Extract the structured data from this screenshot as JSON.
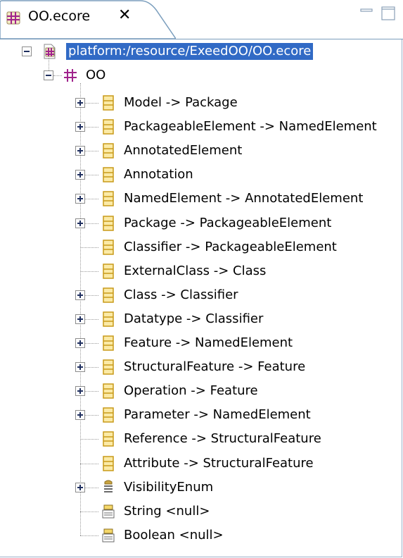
{
  "tab": {
    "title": "OO.ecore",
    "close_glyph": "✕",
    "icon": "ecore-package-icon"
  },
  "window_controls": [
    "minimize-icon",
    "maximize-icon"
  ],
  "tree": {
    "resource": {
      "label": "platform:/resource/ExeedOO/OO.ecore",
      "expanded": true,
      "selected": true
    },
    "package": {
      "label": "OO",
      "expanded": true
    },
    "items": [
      {
        "label": "Model -> Package",
        "kind": "class",
        "expandable": true
      },
      {
        "label": "PackageableElement -> NamedElement",
        "kind": "class",
        "expandable": true
      },
      {
        "label": "AnnotatedElement",
        "kind": "class",
        "expandable": true
      },
      {
        "label": "Annotation",
        "kind": "class",
        "expandable": true
      },
      {
        "label": "NamedElement -> AnnotatedElement",
        "kind": "class",
        "expandable": true
      },
      {
        "label": "Package -> PackageableElement",
        "kind": "class",
        "expandable": true
      },
      {
        "label": "Classifier -> PackageableElement",
        "kind": "class",
        "expandable": false
      },
      {
        "label": "ExternalClass -> Class",
        "kind": "class",
        "expandable": false
      },
      {
        "label": "Class -> Classifier",
        "kind": "class",
        "expandable": true
      },
      {
        "label": "Datatype -> Classifier",
        "kind": "class",
        "expandable": true
      },
      {
        "label": "Feature -> NamedElement",
        "kind": "class",
        "expandable": true
      },
      {
        "label": "StructuralFeature -> Feature",
        "kind": "class",
        "expandable": true
      },
      {
        "label": "Operation -> Feature",
        "kind": "class",
        "expandable": true
      },
      {
        "label": "Parameter -> NamedElement",
        "kind": "class",
        "expandable": true
      },
      {
        "label": "Reference -> StructuralFeature",
        "kind": "class",
        "expandable": false
      },
      {
        "label": "Attribute -> StructuralFeature",
        "kind": "class",
        "expandable": false
      },
      {
        "label": "VisibilityEnum",
        "kind": "enum",
        "expandable": true
      },
      {
        "label": "String <null>",
        "kind": "datatype",
        "expandable": false
      },
      {
        "label": "Boolean <null>",
        "kind": "datatype",
        "expandable": false
      }
    ]
  },
  "colors": {
    "selection": "#316ac5",
    "class_icon": "#e8b830",
    "package_icon": "#a0238c",
    "tree_line": "#9a9a9a",
    "tab_border": "#7b9ebd"
  }
}
